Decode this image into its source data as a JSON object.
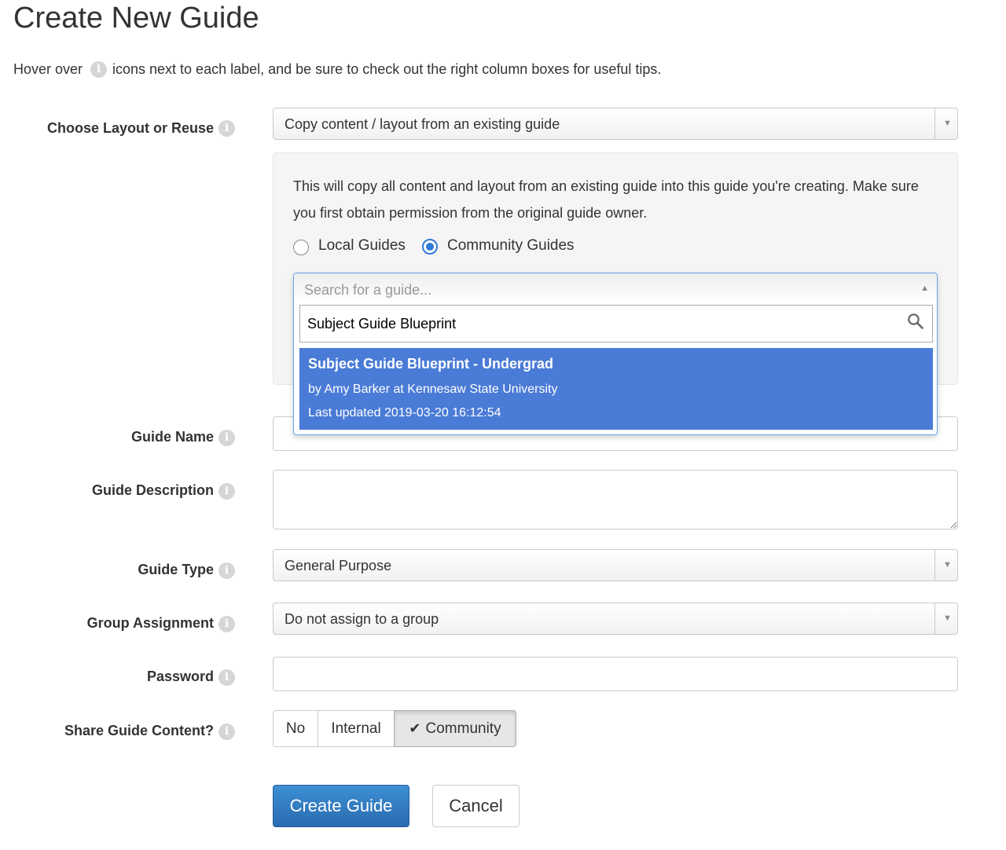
{
  "page": {
    "title": "Create New Guide",
    "intro_before": "Hover over",
    "intro_after": "icons next to each label, and be sure to check out the right column boxes for useful tips."
  },
  "icons": {
    "info": "info-icon",
    "search": "search-icon",
    "check": "check-icon",
    "caret_down": "caret-down-icon",
    "caret_up": "caret-up-icon"
  },
  "form": {
    "layout": {
      "label": "Choose Layout or Reuse",
      "selected": "Copy content / layout from an existing guide"
    },
    "copy_panel": {
      "description": "This will copy all content and layout from an existing guide into this guide you're creating. Make sure you first obtain permission from the original guide owner.",
      "radio_local": "Local Guides",
      "radio_community": "Community Guides",
      "selected_radio": "Community Guides",
      "search": {
        "placeholder": "Search for a guide...",
        "query": "Subject Guide Blueprint",
        "results": [
          {
            "title": "Subject Guide Blueprint - Undergrad",
            "author": "by Amy Barker at Kennesaw State University",
            "updated": "Last updated 2019-03-20 16:12:54"
          }
        ]
      }
    },
    "guide_name": {
      "label": "Guide Name",
      "value": ""
    },
    "guide_description": {
      "label": "Guide Description",
      "value": ""
    },
    "guide_type": {
      "label": "Guide Type",
      "selected": "General Purpose"
    },
    "group_assignment": {
      "label": "Group Assignment",
      "selected": "Do not assign to a group"
    },
    "password": {
      "label": "Password",
      "value": ""
    },
    "share": {
      "label": "Share Guide Content?",
      "options": [
        "No",
        "Internal",
        "Community"
      ],
      "selected": "Community"
    },
    "buttons": {
      "create": "Create Guide",
      "cancel": "Cancel"
    }
  },
  "colors": {
    "primary": "#2f7cc4",
    "selection": "#4a7bd6",
    "radio_checked": "#2e79d9"
  }
}
